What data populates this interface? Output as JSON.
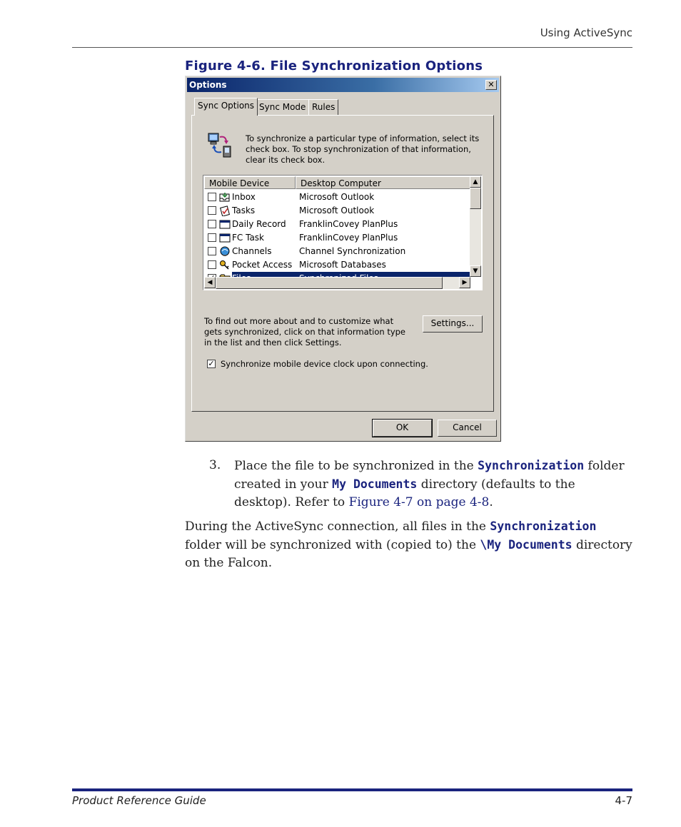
{
  "header": {
    "section": "Using ActiveSync"
  },
  "figure": {
    "caption": "Figure 4-6. File Synchronization Options"
  },
  "dialog": {
    "title": "Options",
    "close_glyph": "✕",
    "tabs": [
      "Sync Options",
      "Sync Mode",
      "Rules"
    ],
    "intro": "To synchronize a particular type of information, select its check box. To stop synchronization of that information, clear its check box.",
    "columns": [
      "Mobile Device",
      "Desktop Computer"
    ],
    "rows": [
      {
        "label": "Inbox",
        "desktop": "Microsoft Outlook",
        "checked": ""
      },
      {
        "label": "Tasks",
        "desktop": "Microsoft Outlook",
        "checked": ""
      },
      {
        "label": "Daily Record",
        "desktop": "FranklinCovey PlanPlus",
        "checked": ""
      },
      {
        "label": "FC Task",
        "desktop": "FranklinCovey PlanPlus",
        "checked": ""
      },
      {
        "label": "Channels",
        "desktop": "Channel Synchronization",
        "checked": ""
      },
      {
        "label": "Pocket Access",
        "desktop": "Microsoft Databases",
        "checked": ""
      },
      {
        "label": "Files",
        "desktop": "Synchronized Files",
        "checked": "✓"
      }
    ],
    "help": "To find out more about and to customize what gets synchronized, click on that information type in the list and then click Settings.",
    "settings_label": "Settings...",
    "clock_label": "Synchronize mobile device clock upon connecting.",
    "clock_checked": "✓",
    "ok_label": "OK",
    "cancel_label": "Cancel"
  },
  "step": {
    "number": "3.",
    "t1": "Place the file to be synchronized in the ",
    "c1": "Synchronization",
    "t2": " folder created in your ",
    "c2": "My Documents",
    "t3": " directory (defaults to the desktop). Refer to ",
    "link": "Figure 4-7 on page 4-8",
    "t4": "."
  },
  "para": {
    "t1": "During the ActiveSync connection, all files in the ",
    "c1": "Synchronization",
    "t2": " folder will be synchronized with (copied to) the ",
    "c2": "\\My Documents",
    "t3": " directory on the Falcon."
  },
  "footer": {
    "title": "Product Reference Guide",
    "page": "4-7"
  }
}
